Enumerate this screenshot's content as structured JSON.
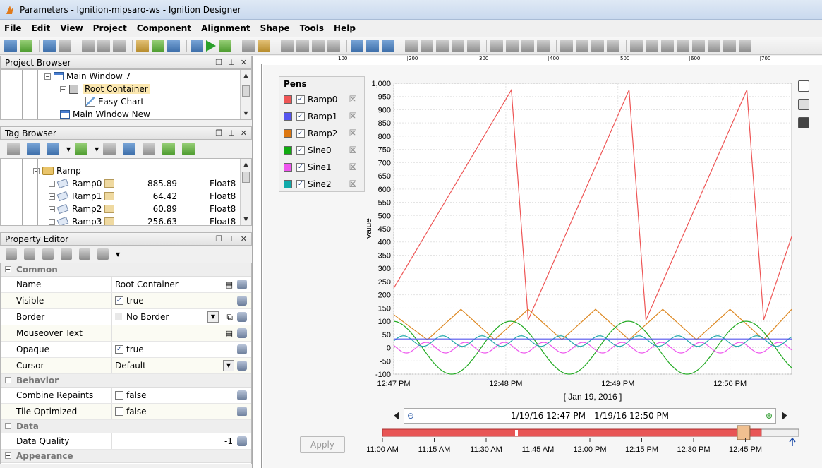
{
  "window": {
    "title": "Parameters - Ignition-mipsaro-ws - Ignition Designer"
  },
  "menu": [
    {
      "label": "File",
      "u": "F",
      "rest": "ile"
    },
    {
      "label": "Edit",
      "u": "E",
      "rest": "dit"
    },
    {
      "label": "View",
      "u": "V",
      "rest": "iew"
    },
    {
      "label": "Project",
      "u": "P",
      "rest": "roject"
    },
    {
      "label": "Component",
      "u": "C",
      "rest": "omponent"
    },
    {
      "label": "Alignment",
      "u": "A",
      "rest": "lignment"
    },
    {
      "label": "Shape",
      "u": "S",
      "rest": "hape"
    },
    {
      "label": "Tools",
      "u": "T",
      "rest": "ools"
    },
    {
      "label": "Help",
      "u": "H",
      "rest": "elp"
    }
  ],
  "project_browser": {
    "title": "Project Browser",
    "items": [
      "Main Window 7",
      "Root Container",
      "Easy Chart",
      "Main Window New"
    ]
  },
  "tag_browser": {
    "title": "Tag Browser",
    "folder": "Ramp",
    "rows": [
      {
        "name": "Ramp0",
        "value": "885.89",
        "type": "Float8"
      },
      {
        "name": "Ramp1",
        "value": "64.42",
        "type": "Float8"
      },
      {
        "name": "Ramp2",
        "value": "60.89",
        "type": "Float8"
      },
      {
        "name": "Ramp3",
        "value": "256.63",
        "type": "Float8"
      }
    ]
  },
  "property_editor": {
    "title": "Property Editor",
    "categories": {
      "common": "Common",
      "behavior": "Behavior",
      "data": "Data",
      "appearance": "Appearance"
    },
    "common": [
      {
        "name": "Name",
        "value": "Root Container"
      },
      {
        "name": "Visible",
        "value": "true"
      },
      {
        "name": "Border",
        "value": "No Border"
      },
      {
        "name": "Mouseover Text",
        "value": ""
      },
      {
        "name": "Opaque",
        "value": "true"
      },
      {
        "name": "Cursor",
        "value": "Default"
      }
    ],
    "behavior": [
      {
        "name": "Combine Repaints",
        "value": "false"
      },
      {
        "name": "Tile Optimized",
        "value": "false"
      }
    ],
    "data": [
      {
        "name": "Data Quality",
        "value": "-1"
      }
    ]
  },
  "pens": {
    "title": "Pens",
    "items": [
      {
        "name": "Ramp0",
        "color": "#ee5555"
      },
      {
        "name": "Ramp1",
        "color": "#5555ee"
      },
      {
        "name": "Ramp2",
        "color": "#dd7711"
      },
      {
        "name": "Sine0",
        "color": "#11aa11"
      },
      {
        "name": "Sine1",
        "color": "#ee55ee"
      },
      {
        "name": "Sine2",
        "color": "#11aaaa"
      }
    ]
  },
  "apply_label": "Apply",
  "range_text": "1/19/16 12:47 PM - 1/19/16 12:50 PM",
  "ruler_labels": [
    "100",
    "200",
    "300",
    "400",
    "500",
    "600",
    "700"
  ],
  "chart_data": {
    "type": "line",
    "ylabel": "Value",
    "xlabel": "[ Jan 19, 2016 ]",
    "ylim": [
      -100,
      1000
    ],
    "yticks": [
      -100,
      -50,
      0,
      50,
      100,
      150,
      200,
      250,
      300,
      350,
      400,
      450,
      500,
      550,
      600,
      650,
      700,
      750,
      800,
      850,
      900,
      950,
      1000
    ],
    "ytick_labels": [
      "-100",
      "-50",
      "0",
      "50",
      "100",
      "150",
      "200",
      "250",
      "300",
      "350",
      "400",
      "450",
      "500",
      "550",
      "600",
      "650",
      "700",
      "750",
      "800",
      "850",
      "900",
      "950",
      "1,000"
    ],
    "xtick_labels": [
      "12:47 PM",
      "12:48 PM",
      "12:49 PM",
      "12:50 PM"
    ],
    "x_minutes": [
      0,
      1,
      2,
      3
    ],
    "xlim": [
      0,
      3.55
    ],
    "series": [
      {
        "name": "Ramp0",
        "color": "#ee5555",
        "points": [
          [
            0,
            225
          ],
          [
            1.05,
            975
          ],
          [
            1.2,
            105
          ],
          [
            2.1,
            975
          ],
          [
            2.25,
            105
          ],
          [
            3.15,
            975
          ],
          [
            3.3,
            105
          ],
          [
            3.55,
            420
          ]
        ]
      },
      {
        "name": "Ramp2",
        "color": "#dd8822",
        "points": [
          [
            0,
            125
          ],
          [
            0.3,
            30
          ],
          [
            0.6,
            145
          ],
          [
            0.9,
            30
          ],
          [
            1.2,
            145
          ],
          [
            1.5,
            30
          ],
          [
            1.8,
            145
          ],
          [
            2.1,
            30
          ],
          [
            2.4,
            145
          ],
          [
            2.7,
            30
          ],
          [
            3.0,
            145
          ],
          [
            3.3,
            30
          ],
          [
            3.55,
            145
          ]
        ]
      },
      {
        "name": "Sine0",
        "color": "#22aa22",
        "amp": 100,
        "period": 1.05,
        "phase": 0.78,
        "offset": 0
      },
      {
        "name": "Sine1",
        "color": "#ee55ee",
        "amp": 20,
        "period": 0.35,
        "phase": 0.2,
        "offset": 0
      },
      {
        "name": "Sine2",
        "color": "#22aaaa",
        "amp": 20,
        "period": 0.35,
        "phase": 0.0,
        "offset": 25
      },
      {
        "name": "Ramp1",
        "color": "#5555ee",
        "constant": 33
      }
    ]
  },
  "timeline": {
    "labels": [
      "11:00 AM",
      "11:15 AM",
      "11:30 AM",
      "11:45 AM",
      "12:00 PM",
      "12:15 PM",
      "12:30 PM",
      "12:45 PM"
    ],
    "selection_fraction": 0.91,
    "bar_color": "#e85555"
  }
}
